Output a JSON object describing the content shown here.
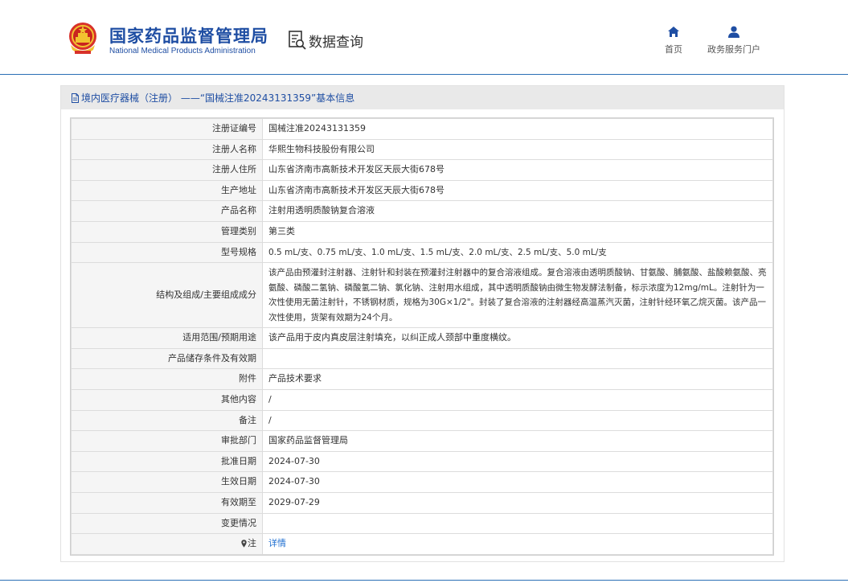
{
  "header": {
    "brand_cn": "国家药品监督管理局",
    "brand_en": "National Medical Products Administration",
    "query_label": "数据查询",
    "nav": [
      {
        "label": "首页",
        "icon": "home-icon"
      },
      {
        "label": "政务服务门户",
        "icon": "user-icon"
      }
    ]
  },
  "panel": {
    "title": "境内医疗器械（注册） ——“国械注准20243131359”基本信息"
  },
  "rows": [
    {
      "label": "注册证编号",
      "value": "国械注准20243131359"
    },
    {
      "label": "注册人名称",
      "value": "华熙生物科技股份有限公司"
    },
    {
      "label": "注册人住所",
      "value": "山东省济南市高新技术开发区天辰大街678号"
    },
    {
      "label": "生产地址",
      "value": "山东省济南市高新技术开发区天辰大街678号"
    },
    {
      "label": "产品名称",
      "value": "注射用透明质酸钠复合溶液"
    },
    {
      "label": "管理类别",
      "value": "第三类"
    },
    {
      "label": "型号规格",
      "value": "0.5 mL/支、0.75 mL/支、1.0 mL/支、1.5 mL/支、2.0 mL/支、2.5 mL/支、5.0 mL/支"
    },
    {
      "label": "结构及组成/主要组成成分",
      "value": "该产品由预灌封注射器、注射针和封装在预灌封注射器中的复合溶液组成。复合溶液由透明质酸钠、甘氨酸、脯氨酸、盐酸赖氨酸、亮氨酸、磷酸二氢钠、磷酸氢二钠、氯化钠、注射用水组成，其中透明质酸钠由微生物发酵法制备，标示浓度为12mg/mL。注射针为一次性使用无菌注射针，不锈钢材质，规格为30G×1/2\"。封装了复合溶液的注射器经高温蒸汽灭菌，注射针经环氧乙烷灭菌。该产品一次性使用，货架有效期为24个月。"
    },
    {
      "label": "适用范围/预期用途",
      "value": "该产品用于皮内真皮层注射填充，以纠正成人颈部中重度横纹。"
    },
    {
      "label": "产品储存条件及有效期",
      "value": ""
    },
    {
      "label": "附件",
      "value": "产品技术要求"
    },
    {
      "label": "其他内容",
      "value": "/"
    },
    {
      "label": "备注",
      "value": "/"
    },
    {
      "label": "审批部门",
      "value": "国家药品监督管理局"
    },
    {
      "label": "批准日期",
      "value": "2024-07-30"
    },
    {
      "label": "生效日期",
      "value": "2024-07-30"
    },
    {
      "label": "有效期至",
      "value": "2029-07-29"
    },
    {
      "label": "变更情况",
      "value": ""
    },
    {
      "label": "注",
      "value": "详情"
    }
  ]
}
